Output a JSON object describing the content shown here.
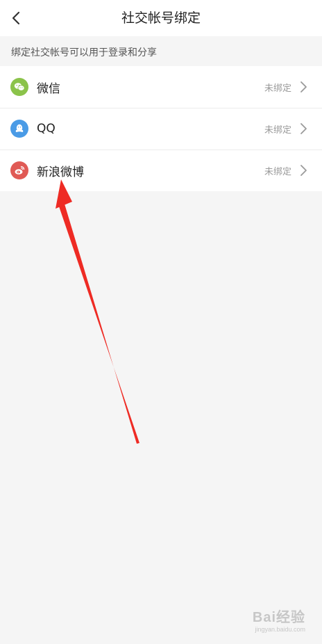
{
  "header": {
    "title": "社交帐号绑定"
  },
  "hint": "绑定社交帐号可以用于登录和分享",
  "accounts": [
    {
      "label": "微信",
      "status": "未绑定",
      "icon": "wechat-icon",
      "color": "#8bc34a"
    },
    {
      "label": "QQ",
      "status": "未绑定",
      "icon": "qq-icon",
      "color": "#4a9be6"
    },
    {
      "label": "新浪微博",
      "status": "未绑定",
      "icon": "weibo-icon",
      "color": "#e05a55"
    }
  ],
  "annotation": {
    "color": "#ee2b24"
  },
  "watermark": {
    "brand": "Bai经验",
    "url": "jingyan.baidu.com"
  }
}
